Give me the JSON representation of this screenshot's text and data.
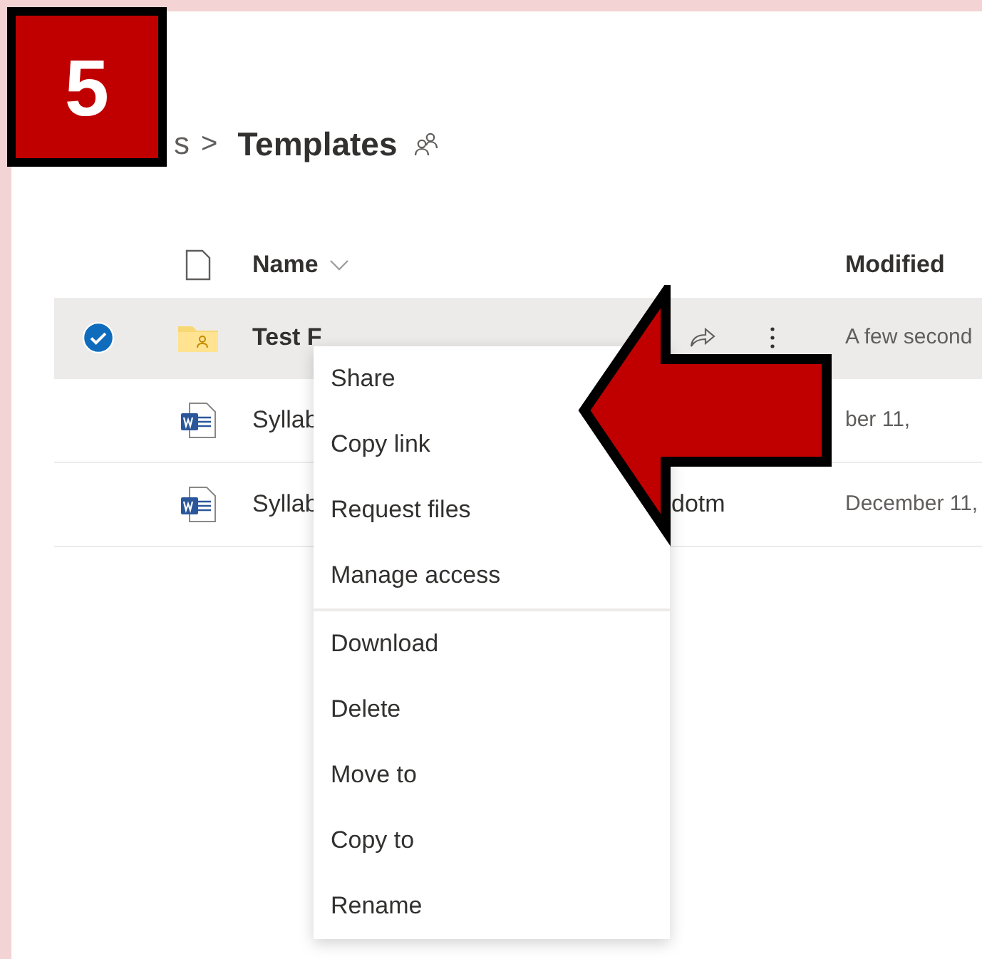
{
  "step_badge": "5",
  "breadcrumb": {
    "parent_tail": "s",
    "separator": ">",
    "current": "Templates"
  },
  "table": {
    "columns": [
      {
        "label": "Name"
      },
      {
        "label": "Modified"
      }
    ],
    "rows": [
      {
        "kind": "folder",
        "selected": true,
        "name": "Test F",
        "name_tail": "",
        "modified": "A few second",
        "actions": true
      },
      {
        "kind": "word",
        "selected": false,
        "name": "Syllab",
        "name_tail": "",
        "modified": "ber 11,",
        "actions": false
      },
      {
        "kind": "word",
        "selected": false,
        "name": "Syllab",
        "name_tail": "dotm",
        "modified": "December 11,",
        "actions": false
      }
    ]
  },
  "context_menu": {
    "groups": [
      {
        "items": [
          "Share",
          "Copy link",
          "Request files",
          "Manage access"
        ]
      },
      {
        "items": [
          "Download",
          "Delete",
          "Move to",
          "Copy to",
          "Rename"
        ]
      }
    ]
  }
}
